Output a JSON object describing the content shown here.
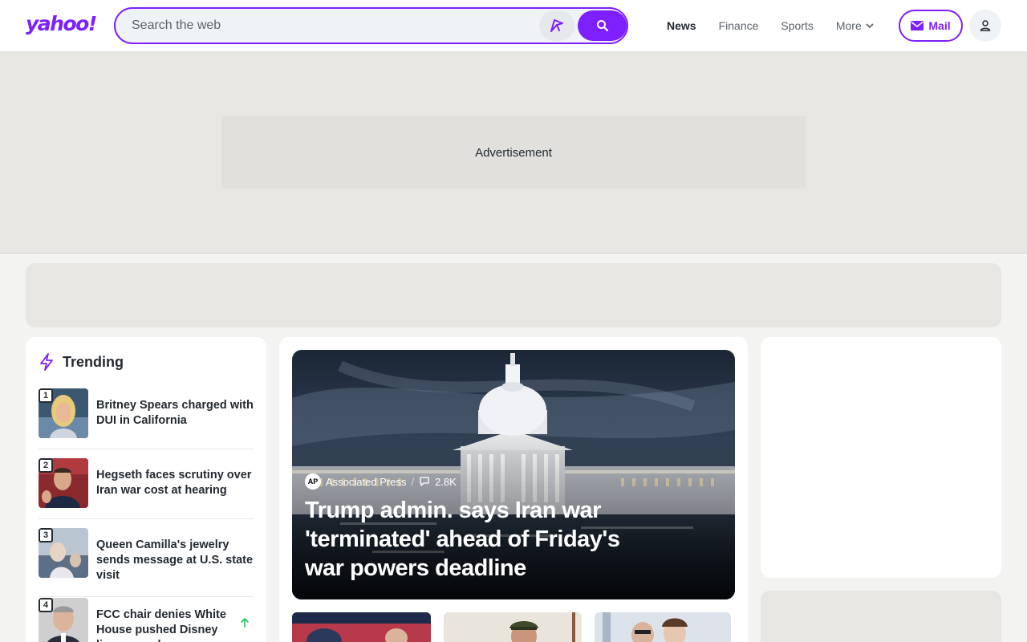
{
  "header": {
    "logo": "yahoo!",
    "search": {
      "placeholder": "Search the web",
      "value": ""
    },
    "nav": [
      {
        "label": "News"
      },
      {
        "label": "Finance"
      },
      {
        "label": "Sports"
      },
      {
        "label": "More"
      }
    ],
    "mail_label": "Mail",
    "accent": "#7e1fff"
  },
  "ad": {
    "label": "Advertisement"
  },
  "trending": {
    "title": "Trending",
    "items": [
      {
        "rank": "1",
        "headline": "Britney Spears charged with DUI in California"
      },
      {
        "rank": "2",
        "headline": "Hegseth faces scrutiny over Iran war cost at hearing"
      },
      {
        "rank": "3",
        "headline": "Queen Camilla's jewelry sends message at U.S. state visit"
      },
      {
        "rank": "4",
        "headline": "FCC chair denies White House pushed Disney license probe"
      }
    ]
  },
  "hero": {
    "source": "Associated Press",
    "source_logo": "AP",
    "comments": "2.8K",
    "headline": "Trump admin. says Iran war 'terminated' ahead of Friday's war powers deadline"
  }
}
